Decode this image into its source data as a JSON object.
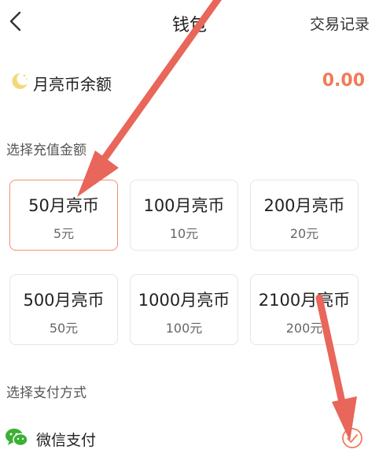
{
  "header": {
    "title": "钱包",
    "records_label": "交易记录"
  },
  "balance": {
    "label": "月亮币余额",
    "value": "0.00"
  },
  "recharge": {
    "section_title": "选择充值金额",
    "options": [
      {
        "amount": "50月亮币",
        "price": "5元",
        "selected": true
      },
      {
        "amount": "100月亮币",
        "price": "10元",
        "selected": false
      },
      {
        "amount": "200月亮币",
        "price": "20元",
        "selected": false
      },
      {
        "amount": "500月亮币",
        "price": "50元",
        "selected": false
      },
      {
        "amount": "1000月亮币",
        "price": "100元",
        "selected": false
      },
      {
        "amount": "2100月亮币",
        "price": "200元",
        "selected": false
      }
    ]
  },
  "payment": {
    "section_title": "选择支付方式",
    "methods": [
      {
        "label": "微信支付",
        "selected": true
      }
    ]
  },
  "colors": {
    "accent": "#f07b5a",
    "selected_border": "#f0906f",
    "wechat_green": "#3cb034",
    "annotation_arrow": "#e8665a"
  }
}
